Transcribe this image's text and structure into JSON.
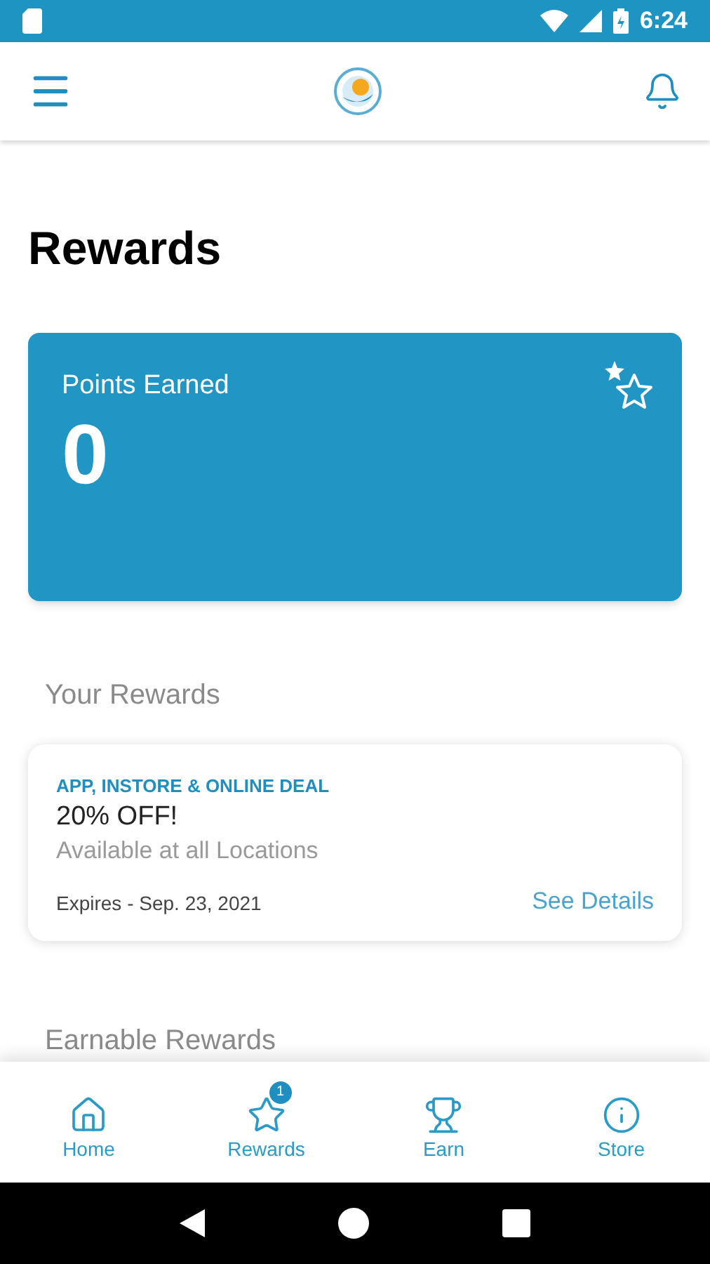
{
  "status_bar": {
    "time": "6:24"
  },
  "page": {
    "title": "Rewards"
  },
  "points_card": {
    "label": "Points Earned",
    "value": "0"
  },
  "your_rewards": {
    "heading": "Your Rewards",
    "rewards": [
      {
        "category": "APP, INSTORE & ONLINE DEAL",
        "title": "20% OFF!",
        "subtitle": "Available at all Locations",
        "expires": "Expires - Sep. 23, 2021",
        "link": "See Details"
      }
    ]
  },
  "earnable_rewards": {
    "heading": "Earnable Rewards"
  },
  "bottom_nav": [
    {
      "kind": "home",
      "label": "Home"
    },
    {
      "kind": "star",
      "label": "Rewards",
      "badge": "1"
    },
    {
      "kind": "trophy",
      "label": "Earn"
    },
    {
      "kind": "info",
      "label": "Store"
    }
  ]
}
